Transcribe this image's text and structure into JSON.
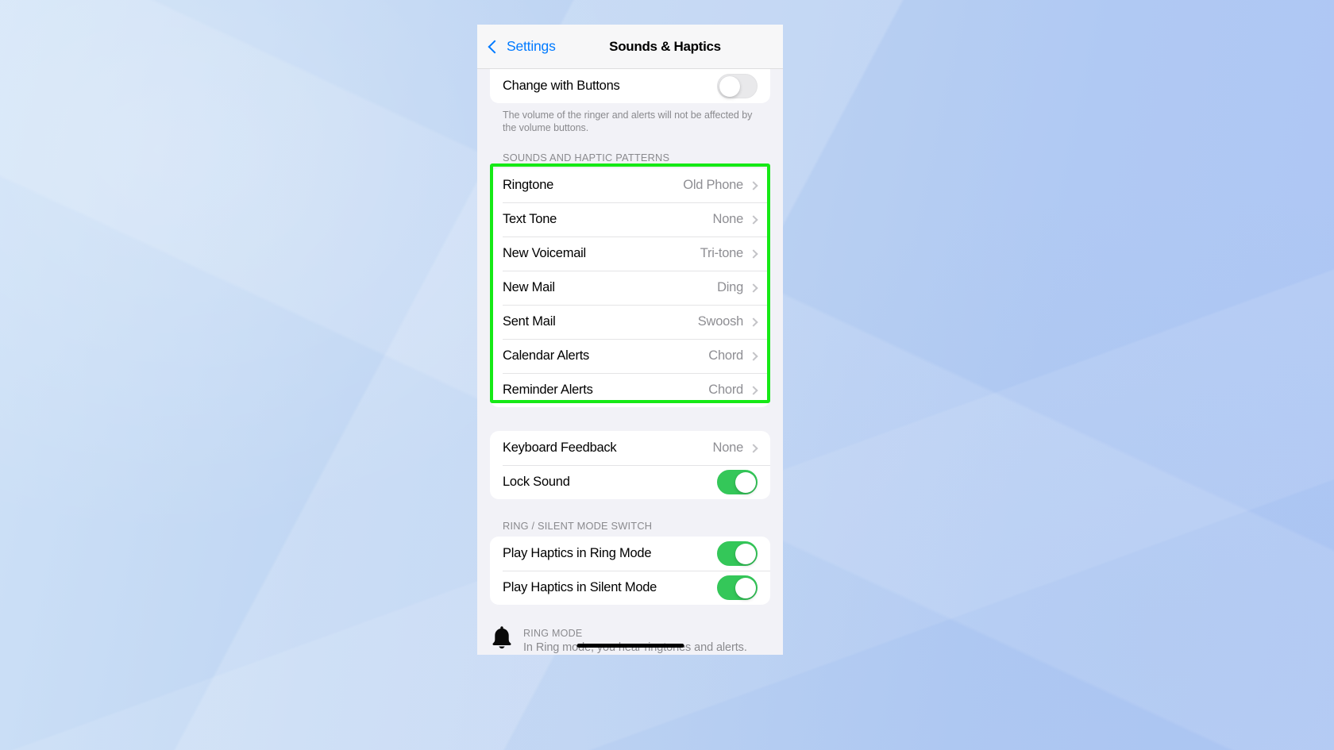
{
  "wallpaper": {
    "base_color": "#c0d6f3"
  },
  "navbar": {
    "back_label": "Settings",
    "title": "Sounds & Haptics"
  },
  "volume_section": {
    "row": {
      "label": "Change with Buttons",
      "toggle_state": "off"
    },
    "caption": "The volume of the ringer and alerts will not be affected by the volume buttons."
  },
  "sounds_section": {
    "header": "SOUNDS AND HAPTIC PATTERNS",
    "highlighted": true,
    "rows": [
      {
        "label": "Ringtone",
        "value": "Old Phone"
      },
      {
        "label": "Text Tone",
        "value": "None"
      },
      {
        "label": "New Voicemail",
        "value": "Tri-tone"
      },
      {
        "label": "New Mail",
        "value": "Ding"
      },
      {
        "label": "Sent Mail",
        "value": "Swoosh"
      },
      {
        "label": "Calendar Alerts",
        "value": "Chord"
      },
      {
        "label": "Reminder Alerts",
        "value": "Chord"
      }
    ]
  },
  "feedback_section": {
    "keyboard": {
      "label": "Keyboard Feedback",
      "value": "None"
    },
    "lock": {
      "label": "Lock Sound",
      "toggle_state": "on"
    }
  },
  "ring_silent_section": {
    "header": "RING / SILENT MODE SWITCH",
    "rows": [
      {
        "label": "Play Haptics in Ring Mode",
        "toggle_state": "on"
      },
      {
        "label": "Play Haptics in Silent Mode",
        "toggle_state": "on"
      }
    ]
  },
  "ring_mode_banner": {
    "icon": "bell-icon",
    "title": "RING MODE",
    "description": "In Ring mode, you hear ringtones and alerts."
  },
  "colors": {
    "accent_blue": "#007aff",
    "toggle_on_green": "#34c759",
    "highlight_green": "#16e916",
    "secondary_text": "#8e8e93"
  }
}
